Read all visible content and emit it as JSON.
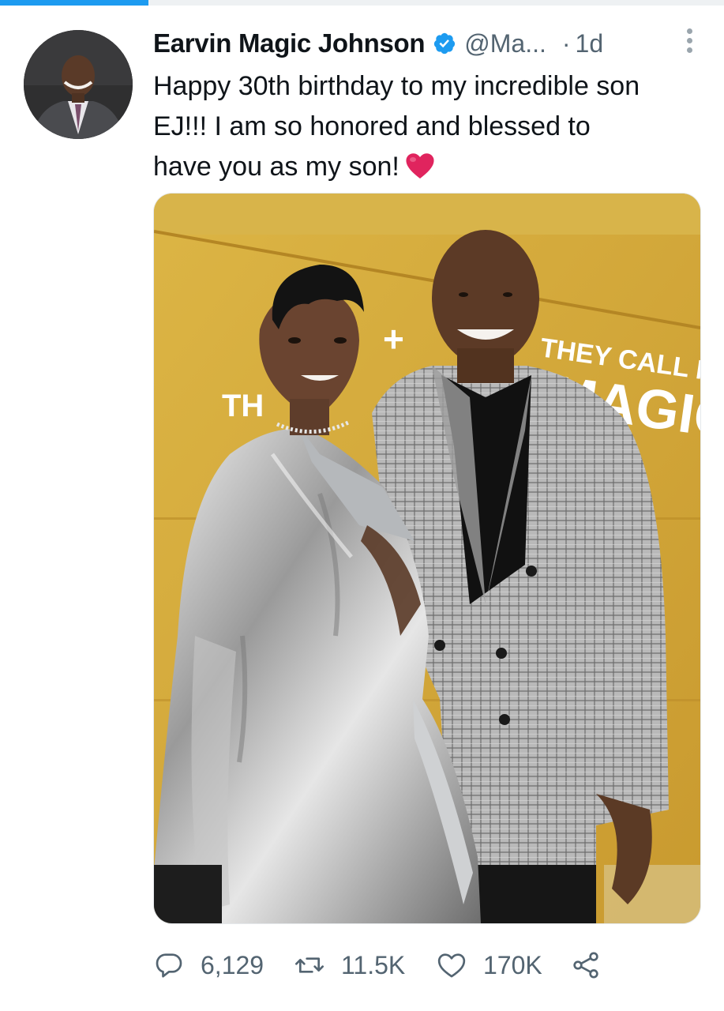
{
  "progress": {
    "fraction": 0.205,
    "color": "#1d9bf0"
  },
  "tweet": {
    "display_name": "Earvin Magic Johnson",
    "handle": "@Ma...",
    "separator": "·",
    "time": "1d",
    "text_lines": [
      "Happy 30th birthday to my incredible son",
      "EJ!!! I am so honored and blessed to",
      "have you as my son!"
    ],
    "emoji": "red-heart-emoji",
    "icons": {
      "verified": "verified-badge-icon",
      "more": "more-vertical-icon"
    },
    "media": {
      "sign_line1": "THEY CALL ME",
      "sign_line2": "MAGIC",
      "partial_text": "TH",
      "plus": "+"
    }
  },
  "actions": {
    "reply": {
      "icon": "reply-icon",
      "count": "6,129"
    },
    "retweet": {
      "icon": "retweet-icon",
      "count": "11.5K"
    },
    "like": {
      "icon": "like-icon",
      "count": "170K"
    },
    "share": {
      "icon": "share-icon"
    }
  },
  "colors": {
    "accent": "#1d9bf0",
    "secondary_text": "#536471",
    "primary_text": "#0f1419",
    "heart": "#e0245e"
  }
}
